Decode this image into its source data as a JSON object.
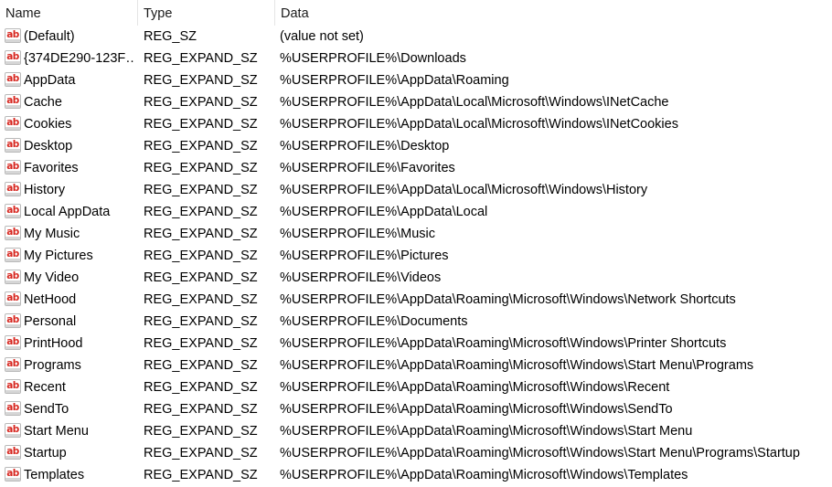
{
  "header": {
    "name": "Name",
    "type": "Type",
    "data": "Data"
  },
  "icon": {
    "name": "string-value-icon",
    "glyph": "ab",
    "color": "#d7261f"
  },
  "rows": [
    {
      "name": "(Default)",
      "type": "REG_SZ",
      "data": "(value not set)"
    },
    {
      "name": "{374DE290-123F…",
      "type": "REG_EXPAND_SZ",
      "data": "%USERPROFILE%\\Downloads"
    },
    {
      "name": "AppData",
      "type": "REG_EXPAND_SZ",
      "data": "%USERPROFILE%\\AppData\\Roaming"
    },
    {
      "name": "Cache",
      "type": "REG_EXPAND_SZ",
      "data": "%USERPROFILE%\\AppData\\Local\\Microsoft\\Windows\\INetCache"
    },
    {
      "name": "Cookies",
      "type": "REG_EXPAND_SZ",
      "data": "%USERPROFILE%\\AppData\\Local\\Microsoft\\Windows\\INetCookies"
    },
    {
      "name": "Desktop",
      "type": "REG_EXPAND_SZ",
      "data": "%USERPROFILE%\\Desktop"
    },
    {
      "name": "Favorites",
      "type": "REG_EXPAND_SZ",
      "data": "%USERPROFILE%\\Favorites"
    },
    {
      "name": "History",
      "type": "REG_EXPAND_SZ",
      "data": "%USERPROFILE%\\AppData\\Local\\Microsoft\\Windows\\History"
    },
    {
      "name": "Local AppData",
      "type": "REG_EXPAND_SZ",
      "data": "%USERPROFILE%\\AppData\\Local"
    },
    {
      "name": "My Music",
      "type": "REG_EXPAND_SZ",
      "data": "%USERPROFILE%\\Music"
    },
    {
      "name": "My Pictures",
      "type": "REG_EXPAND_SZ",
      "data": "%USERPROFILE%\\Pictures"
    },
    {
      "name": "My Video",
      "type": "REG_EXPAND_SZ",
      "data": "%USERPROFILE%\\Videos"
    },
    {
      "name": "NetHood",
      "type": "REG_EXPAND_SZ",
      "data": "%USERPROFILE%\\AppData\\Roaming\\Microsoft\\Windows\\Network Shortcuts"
    },
    {
      "name": "Personal",
      "type": "REG_EXPAND_SZ",
      "data": "%USERPROFILE%\\Documents"
    },
    {
      "name": "PrintHood",
      "type": "REG_EXPAND_SZ",
      "data": "%USERPROFILE%\\AppData\\Roaming\\Microsoft\\Windows\\Printer Shortcuts"
    },
    {
      "name": "Programs",
      "type": "REG_EXPAND_SZ",
      "data": "%USERPROFILE%\\AppData\\Roaming\\Microsoft\\Windows\\Start Menu\\Programs"
    },
    {
      "name": "Recent",
      "type": "REG_EXPAND_SZ",
      "data": "%USERPROFILE%\\AppData\\Roaming\\Microsoft\\Windows\\Recent"
    },
    {
      "name": "SendTo",
      "type": "REG_EXPAND_SZ",
      "data": "%USERPROFILE%\\AppData\\Roaming\\Microsoft\\Windows\\SendTo"
    },
    {
      "name": "Start Menu",
      "type": "REG_EXPAND_SZ",
      "data": "%USERPROFILE%\\AppData\\Roaming\\Microsoft\\Windows\\Start Menu"
    },
    {
      "name": "Startup",
      "type": "REG_EXPAND_SZ",
      "data": "%USERPROFILE%\\AppData\\Roaming\\Microsoft\\Windows\\Start Menu\\Programs\\Startup"
    },
    {
      "name": "Templates",
      "type": "REG_EXPAND_SZ",
      "data": "%USERPROFILE%\\AppData\\Roaming\\Microsoft\\Windows\\Templates"
    }
  ]
}
